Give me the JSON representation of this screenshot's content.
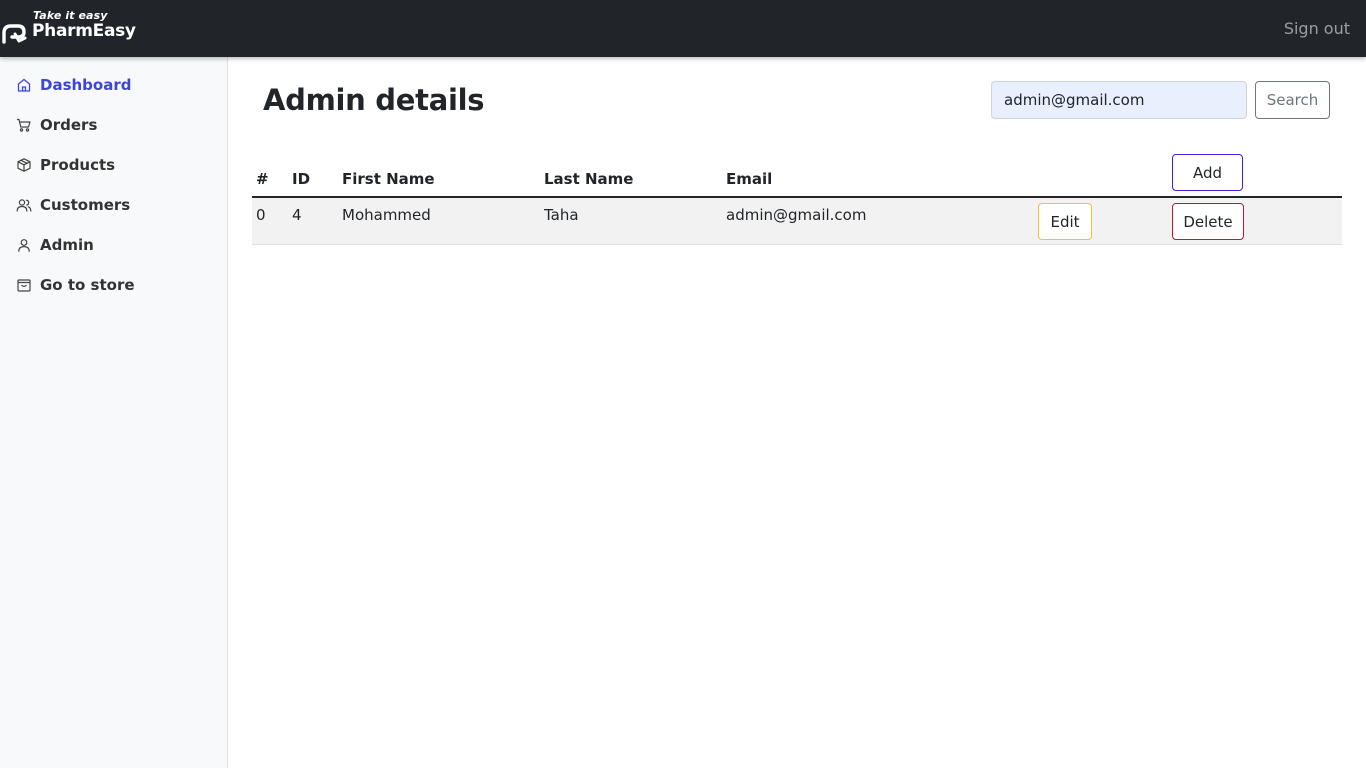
{
  "app": {
    "brand_tagline": "Take it easy",
    "brand_name": "PharmEasy",
    "sign_out": "Sign out"
  },
  "colors": {
    "navbar": "#212529",
    "sidebar": "#f8f9fa",
    "active_link": "#3b45d6",
    "add_border": "#4b1ae0",
    "edit_border": "#f2c037",
    "delete_border": "#c0183a"
  },
  "sidebar": {
    "items": [
      {
        "label": "Dashboard",
        "icon": "home-icon",
        "active": true
      },
      {
        "label": "Orders",
        "icon": "cart-icon",
        "active": false
      },
      {
        "label": "Products",
        "icon": "box-icon",
        "active": false
      },
      {
        "label": "Customers",
        "icon": "users-icon",
        "active": false
      },
      {
        "label": "Admin",
        "icon": "user-icon",
        "active": false
      },
      {
        "label": "Go to store",
        "icon": "bag-icon",
        "active": false
      }
    ]
  },
  "main": {
    "title": "Admin details",
    "search": {
      "value": "admin@gmail.com",
      "button": "Search"
    },
    "add_button": "Add",
    "table": {
      "columns": [
        "#",
        "ID",
        "First Name",
        "Last Name",
        "Email"
      ],
      "rows": [
        {
          "index": "0",
          "id": "4",
          "first_name": "Mohammed",
          "last_name": "Taha",
          "email": "admin@gmail.com",
          "edit": "Edit",
          "delete": "Delete"
        }
      ]
    }
  }
}
